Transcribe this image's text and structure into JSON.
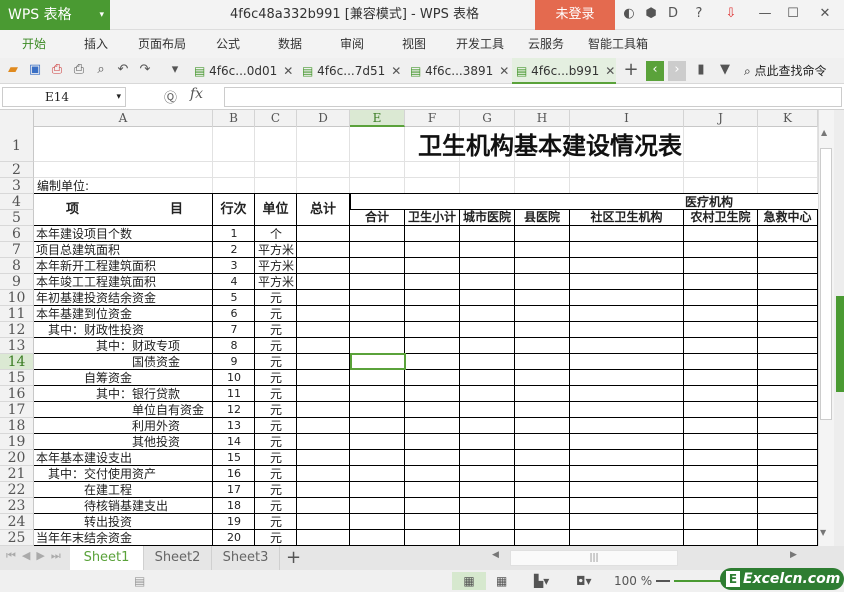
{
  "app": {
    "logo": "WPS 表格",
    "window_title": "4f6c48a332b991 [兼容模式] - WPS 表格",
    "login": "未登录"
  },
  "menu": [
    "开始",
    "插入",
    "页面布局",
    "公式",
    "数据",
    "审阅",
    "视图",
    "开发工具",
    "云服务",
    "智能工具箱"
  ],
  "doc_tabs": [
    "4f6c...0d01",
    "4f6c...7d51",
    "4f6c...3891",
    "4f6c...b991"
  ],
  "active_doc_tab": 3,
  "search_command": "点此查找命令",
  "name_box": "E14",
  "fx": "fx",
  "columns": [
    "A",
    "B",
    "C",
    "D",
    "E",
    "F",
    "G",
    "H",
    "I",
    "J",
    "K"
  ],
  "selected_column": "E",
  "selected_row": 14,
  "row_numbers": [
    1,
    2,
    3,
    4,
    5,
    6,
    7,
    8,
    9,
    10,
    11,
    12,
    13,
    14,
    15,
    16,
    17,
    18,
    19,
    20,
    21,
    22,
    23,
    24,
    25
  ],
  "sheet": {
    "title": "卫生机构基本建设情况表",
    "compiler_label": "编制单位:",
    "headers": {
      "item": "项",
      "item2": "目",
      "row_no": "行次",
      "unit": "单位",
      "total": "总计",
      "group": "医疗机构",
      "sub": [
        "合计",
        "卫生小计",
        "城市医院",
        "县医院",
        "社区卫生机构",
        "农村卫生院",
        "急救中心"
      ]
    },
    "rows": [
      {
        "label": "本年建设项目个数",
        "indent": 0,
        "no": "1",
        "unit": "个"
      },
      {
        "label": "项目总建筑面积",
        "indent": 0,
        "no": "2",
        "unit": "平方米"
      },
      {
        "label": "本年新开工程建筑面积",
        "indent": 0,
        "no": "3",
        "unit": "平方米"
      },
      {
        "label": "本年竣工工程建筑面积",
        "indent": 0,
        "no": "4",
        "unit": "平方米"
      },
      {
        "label": "年初基建投资结余资金",
        "indent": 0,
        "no": "5",
        "unit": "元"
      },
      {
        "label": "本年基建到位资金",
        "indent": 0,
        "no": "6",
        "unit": "元"
      },
      {
        "label": "其中：财政性投资",
        "indent": 1,
        "no": "7",
        "unit": "元"
      },
      {
        "label": "其中：财政专项",
        "indent": 3,
        "no": "8",
        "unit": "元"
      },
      {
        "label": "国债资金",
        "indent": 4,
        "no": "9",
        "unit": "元"
      },
      {
        "label": "自筹资金",
        "indent": 2,
        "no": "10",
        "unit": "元"
      },
      {
        "label": "其中：银行贷款",
        "indent": 3,
        "no": "11",
        "unit": "元"
      },
      {
        "label": "单位自有资金",
        "indent": 4,
        "no": "12",
        "unit": "元"
      },
      {
        "label": "利用外资",
        "indent": 4,
        "no": "13",
        "unit": "元"
      },
      {
        "label": "其他投资",
        "indent": 4,
        "no": "14",
        "unit": "元"
      },
      {
        "label": "本年基本建设支出",
        "indent": 0,
        "no": "15",
        "unit": "元"
      },
      {
        "label": "其中：交付使用资产",
        "indent": 1,
        "no": "16",
        "unit": "元"
      },
      {
        "label": "在建工程",
        "indent": 2,
        "no": "17",
        "unit": "元"
      },
      {
        "label": "待核销基建支出",
        "indent": 2,
        "no": "18",
        "unit": "元"
      },
      {
        "label": "转出投资",
        "indent": 2,
        "no": "19",
        "unit": "元"
      },
      {
        "label": "当年年末结余资金",
        "indent": 0,
        "no": "20",
        "unit": "元"
      }
    ]
  },
  "sheet_tabs": [
    "Sheet1",
    "Sheet2",
    "Sheet3"
  ],
  "active_sheet": 0,
  "zoom": "100 %",
  "watermark": "Excelcn.com"
}
